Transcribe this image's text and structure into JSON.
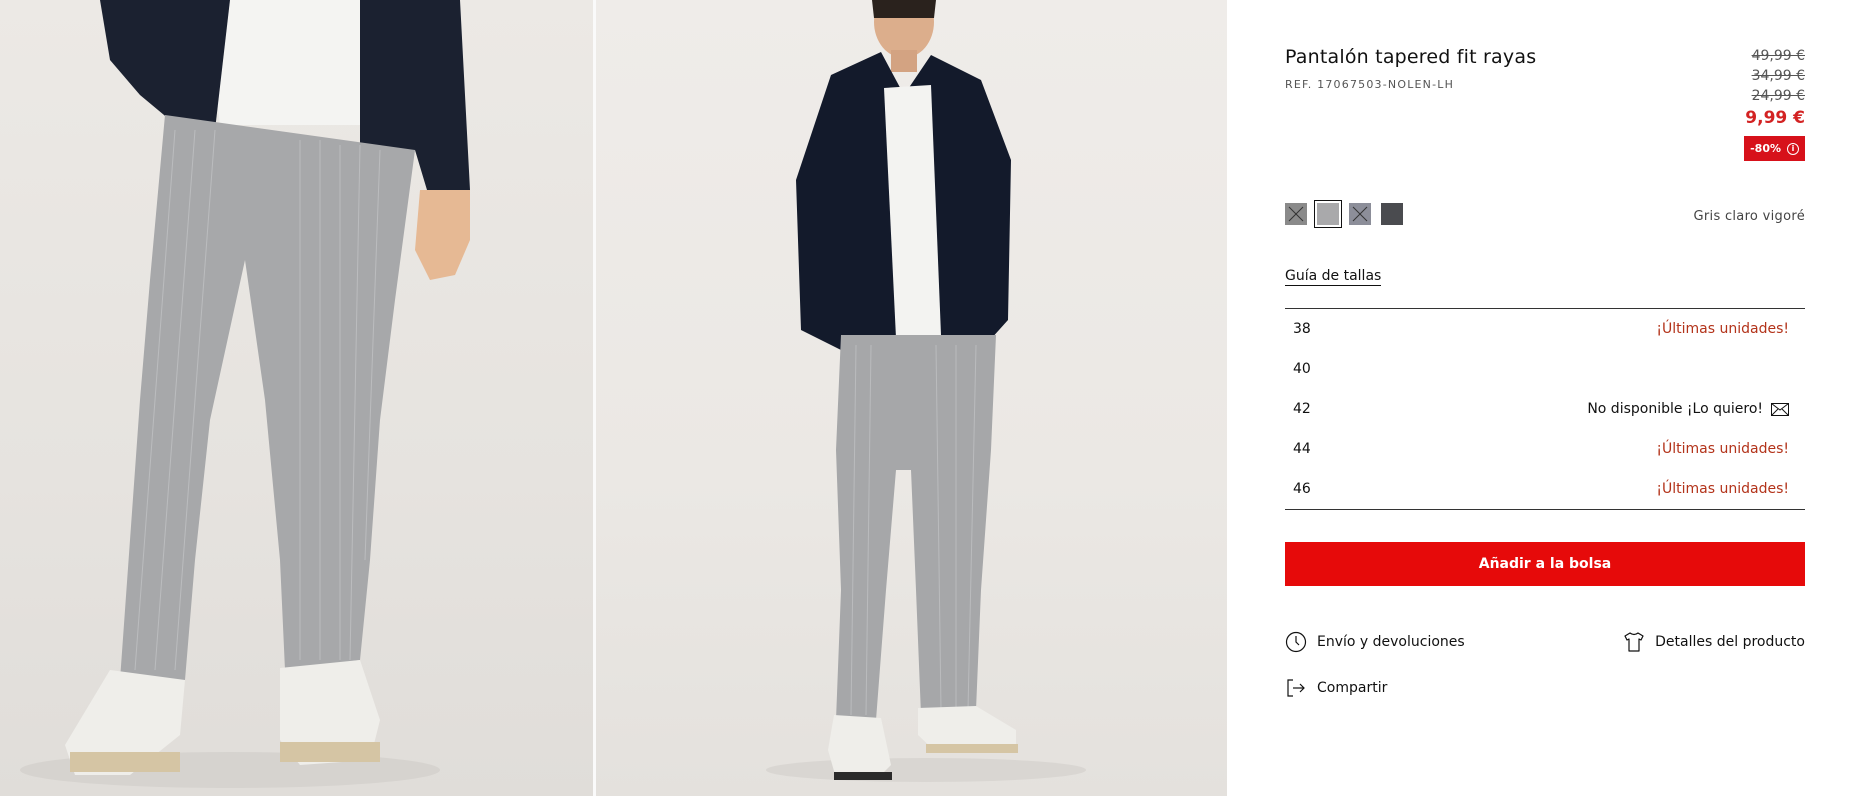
{
  "product": {
    "title": "Pantalón tapered fit rayas",
    "ref": "REF. 17067503-NOLEN-LH"
  },
  "prices": {
    "old": [
      "49,99 €",
      "34,99 €",
      "24,99 €"
    ],
    "current": "9,99 €",
    "discount": "-80%",
    "accent_color": "#d7111a"
  },
  "colors": {
    "selected_name": "Gris claro vigoré",
    "swatches": [
      {
        "color": "#8a8a8a",
        "crossed": true
      },
      {
        "color": "#a9a9ab",
        "crossed": false,
        "selected": true
      },
      {
        "color": "#8c8e99",
        "crossed": true
      },
      {
        "color": "#4a4b4f",
        "crossed": false
      }
    ]
  },
  "size_guide_label": "Guía de tallas",
  "sizes": [
    {
      "size": "38",
      "note": "¡Últimas unidades!"
    },
    {
      "size": "40",
      "note": ""
    },
    {
      "size": "42",
      "note": "No disponible ¡Lo quiero!"
    },
    {
      "size": "44",
      "note": "¡Últimas unidades!"
    },
    {
      "size": "46",
      "note": "¡Últimas unidades!"
    }
  ],
  "add_to_bag_label": "Añadir a la bolsa",
  "links": {
    "shipping": "Envío y devoluciones",
    "details": "Detalles del producto",
    "share": "Compartir"
  }
}
